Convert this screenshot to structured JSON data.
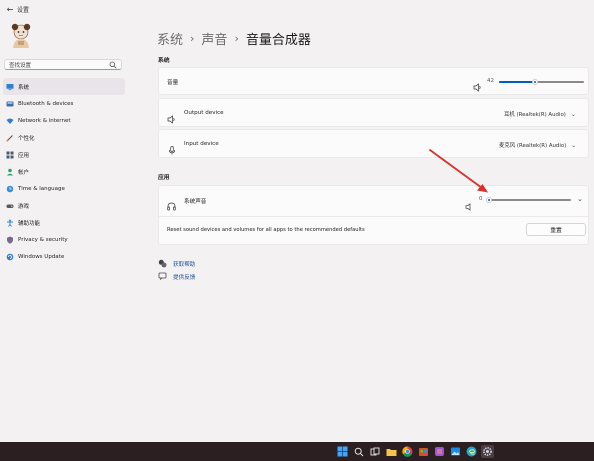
{
  "window": {
    "app_title": "设置"
  },
  "search": {
    "value": "查找设置"
  },
  "sidebar": {
    "items": [
      {
        "label": "系统",
        "icon": "monitor-icon",
        "active": true
      },
      {
        "label": "Bluetooth & devices",
        "icon": "bluetooth-icon",
        "active": false
      },
      {
        "label": "Network & internet",
        "icon": "wifi-icon",
        "active": false
      },
      {
        "label": "个性化",
        "icon": "brush-icon",
        "active": false
      },
      {
        "label": "应用",
        "icon": "apps-icon",
        "active": false
      },
      {
        "label": "帐户",
        "icon": "person-icon",
        "active": false
      },
      {
        "label": "Time & language",
        "icon": "globe-clock-icon",
        "active": false
      },
      {
        "label": "游戏",
        "icon": "gamepad-icon",
        "active": false
      },
      {
        "label": "辅助功能",
        "icon": "accessibility-icon",
        "active": false
      },
      {
        "label": "Privacy & security",
        "icon": "shield-icon",
        "active": false
      },
      {
        "label": "Windows Update",
        "icon": "update-icon",
        "active": false
      }
    ]
  },
  "breadcrumb": {
    "part1": "系统",
    "part2": "声音",
    "part3": "音量合成器"
  },
  "system_section": {
    "label": "系统",
    "volume": {
      "label": "音量",
      "value_text": "42",
      "level": 0.42
    },
    "output": {
      "label": "Output device",
      "value": "耳机 (Realtek(R) Audio)"
    },
    "input": {
      "label": "Input device",
      "value": "麦克风 (Realtek(R) Audio)"
    }
  },
  "apps_section": {
    "label": "应用",
    "system_sounds": {
      "label": "系统声音",
      "value_text": "0",
      "level": 0
    },
    "reset": {
      "text": "Reset sound devices and volumes for all apps to the recommended defaults",
      "button": "重置"
    }
  },
  "links": {
    "help": "获取帮助",
    "feedback": "提供反馈"
  },
  "colors": {
    "accent": "#005fb8",
    "arrow": "#d8322b",
    "taskbar": "#2b1f22"
  }
}
